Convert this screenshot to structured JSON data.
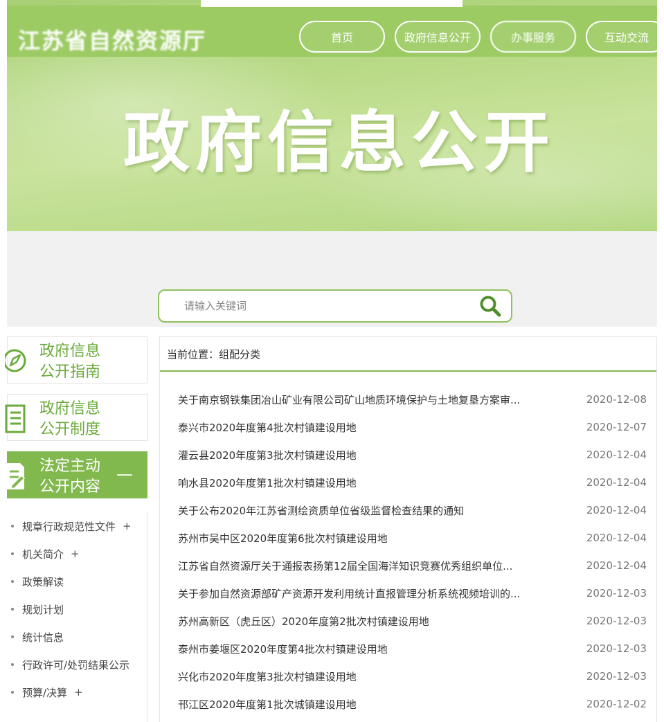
{
  "site": {
    "title": "江苏省自然资源厅",
    "nav": [
      "首页",
      "政府信息公开",
      "办事服务",
      "互动交流"
    ],
    "hero_title": "政府信息公开"
  },
  "search": {
    "placeholder": "请输入关键词"
  },
  "sidebar": {
    "cards": [
      {
        "label": "政府信息公开指南",
        "icon": "compass-icon"
      },
      {
        "label": "政府信息公开制度",
        "icon": "document-list-icon"
      },
      {
        "label": "法定主动公开内容",
        "icon": "edit-document-icon",
        "active": true
      }
    ],
    "collapse_symbol": "—",
    "items": [
      {
        "label": "规章行政规范性文件",
        "expandable": true
      },
      {
        "label": "机关简介",
        "expandable": true
      },
      {
        "label": "政策解读",
        "expandable": false
      },
      {
        "label": "规划计划",
        "expandable": false
      },
      {
        "label": "统计信息",
        "expandable": false
      },
      {
        "label": "行政许可/处罚结果公示",
        "expandable": false
      },
      {
        "label": "预算/决算",
        "expandable": true
      }
    ],
    "plus_symbol": "+"
  },
  "content": {
    "breadcrumb": "当前位置：组配分类",
    "news": [
      {
        "title": "关于南京钢铁集团冶山矿业有限公司矿山地质环境保护与土地复垦方案审...",
        "date": "2020-12-08"
      },
      {
        "title": "泰兴市2020年度第4批次村镇建设用地",
        "date": "2020-12-07"
      },
      {
        "title": "灌云县2020年度第3批次村镇建设用地",
        "date": "2020-12-04"
      },
      {
        "title": "响水县2020年度第1批次村镇建设用地",
        "date": "2020-12-04"
      },
      {
        "title": "关于公布2020年江苏省测绘资质单位省级监督检查结果的通知",
        "date": "2020-12-04"
      },
      {
        "title": "苏州市吴中区2020年度第6批次村镇建设用地",
        "date": "2020-12-04"
      },
      {
        "title": "江苏省自然资源厅关于通报表扬第12届全国海洋知识竞赛优秀组织单位...",
        "date": "2020-12-04"
      },
      {
        "title": "关于参加自然资源部矿产资源开发利用统计直报管理分析系统视频培训的...",
        "date": "2020-12-03"
      },
      {
        "title": "苏州高新区（虎丘区）2020年度第2批次村镇建设用地",
        "date": "2020-12-03"
      },
      {
        "title": "泰州市姜堰区2020年度第4批次村镇建设用地",
        "date": "2020-12-03"
      },
      {
        "title": "兴化市2020年度第3批次村镇建设用地",
        "date": "2020-12-03"
      },
      {
        "title": "邗江区2020年度第1批次城镇建设用地",
        "date": "2020-12-02"
      }
    ]
  },
  "colors": {
    "brand_green": "#82b94e",
    "accent_text": "#6aaa3a"
  }
}
